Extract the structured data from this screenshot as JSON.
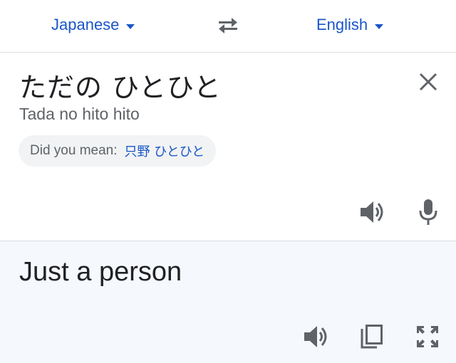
{
  "language_bar": {
    "source_language": "Japanese",
    "target_language": "English",
    "swap_icon": "swap-arrows-icon"
  },
  "source": {
    "text": "ただの ひとひと",
    "romanization": "Tada no hito hito",
    "suggestion_label": "Did you mean:",
    "suggestion_value": "只野 ひとひと",
    "icons": [
      "close-icon",
      "speaker-icon",
      "microphone-icon"
    ]
  },
  "result": {
    "text": "Just a person",
    "icons": [
      "speaker-icon",
      "copy-icon",
      "fullscreen-icon"
    ]
  },
  "colors": {
    "accent": "#1a56c8",
    "text_primary": "#202124",
    "text_secondary": "#5f6368",
    "icon": "#5f6368",
    "divider": "#dadce0",
    "result_background": "#f5f8fc",
    "chip_background": "#f1f3f4"
  }
}
